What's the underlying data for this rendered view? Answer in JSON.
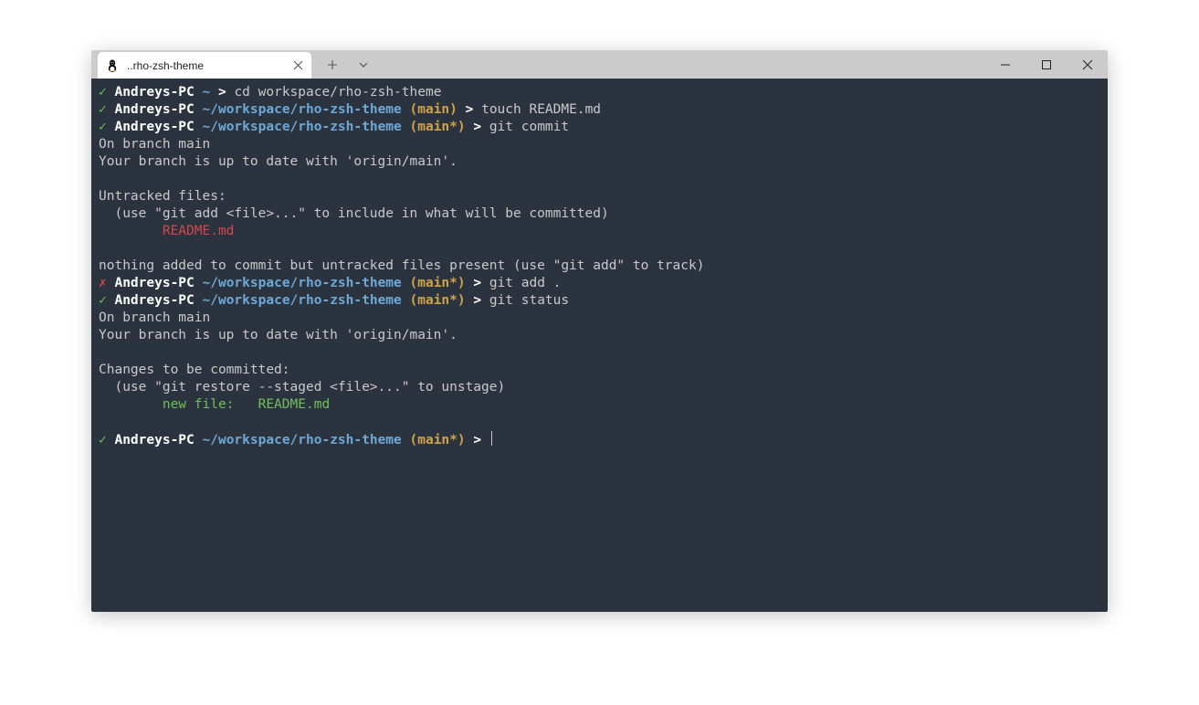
{
  "window": {
    "tab_title": "..rho-zsh-theme",
    "tux_icon": "linux-tux-icon",
    "close_tab": "×",
    "new_tab": "＋",
    "dropdown": "⌄",
    "min": "—",
    "max": "▢",
    "close": "✕"
  },
  "colors": {
    "bg": "#2b333e",
    "titlebar": "#cccccc",
    "ok": "#6fbf5b",
    "err": "#d1484c",
    "path": "#6ea8d6",
    "branch": "#cfa24a",
    "text": "#c9c9c9"
  },
  "lines": {
    "l1_mark": "✓",
    "l1_host": "Andreys-PC",
    "l1_path": "~",
    "l1_sep": ">",
    "l1_cmd": "cd workspace/rho-zsh-theme",
    "l2_mark": "✓",
    "l2_host": "Andreys-PC",
    "l2_path": "~/workspace/rho-zsh-theme",
    "l2_branch": "(main)",
    "l2_sep": ">",
    "l2_cmd": "touch README.md",
    "l3_mark": "✓",
    "l3_host": "Andreys-PC",
    "l3_path": "~/workspace/rho-zsh-theme",
    "l3_branch": "(main*)",
    "l3_sep": ">",
    "l3_cmd": "git commit",
    "l4": "On branch main",
    "l5": "Your branch is up to date with 'origin/main'.",
    "l6": "",
    "l7": "Untracked files:",
    "l8": "  (use \"git add <file>...\" to include in what will be committed)",
    "l9_pad": "        ",
    "l9_file": "README.md",
    "l10": "",
    "l11": "nothing added to commit but untracked files present (use \"git add\" to track)",
    "l12_mark": "✗",
    "l12_host": "Andreys-PC",
    "l12_path": "~/workspace/rho-zsh-theme",
    "l12_branch": "(main*)",
    "l12_sep": ">",
    "l12_cmd": "git add .",
    "l13_mark": "✓",
    "l13_host": "Andreys-PC",
    "l13_path": "~/workspace/rho-zsh-theme",
    "l13_branch": "(main*)",
    "l13_sep": ">",
    "l13_cmd": "git status",
    "l14": "On branch main",
    "l15": "Your branch is up to date with 'origin/main'.",
    "l16": "",
    "l17": "Changes to be committed:",
    "l18": "  (use \"git restore --staged <file>...\" to unstage)",
    "l19_pad": "        ",
    "l19_text": "new file:   README.md",
    "l20": "",
    "l21_mark": "✓",
    "l21_host": "Andreys-PC",
    "l21_path": "~/workspace/rho-zsh-theme",
    "l21_branch": "(main*)",
    "l21_sep": ">",
    "l21_cmd": ""
  }
}
